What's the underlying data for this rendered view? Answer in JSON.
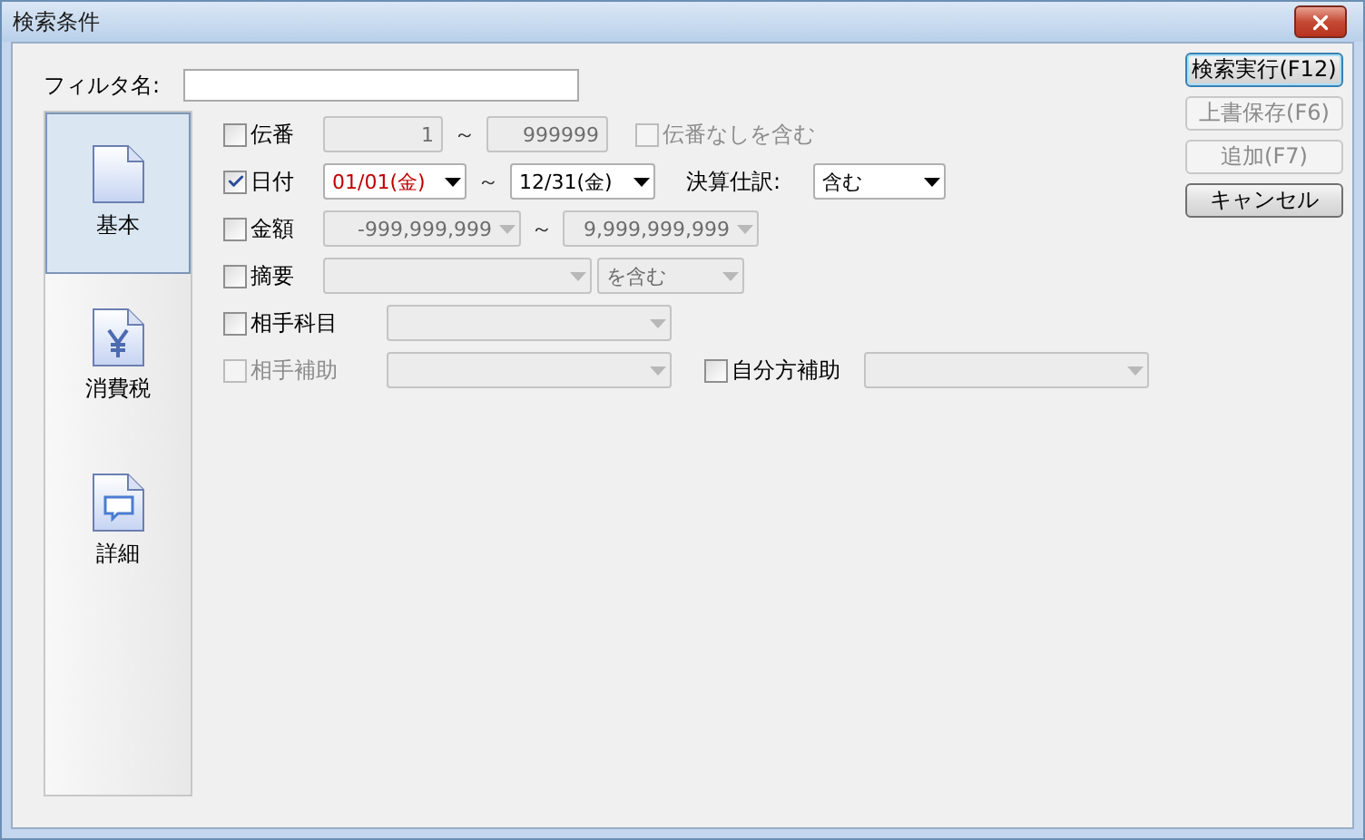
{
  "window": {
    "title": "検索条件"
  },
  "filter_name": {
    "label": "フィルタ名:"
  },
  "sidebar": {
    "items": [
      {
        "label": "基本",
        "selected": true
      },
      {
        "label": "消費税",
        "selected": false
      },
      {
        "label": "詳細",
        "selected": false
      }
    ]
  },
  "rows": [
    {
      "kind": "number_range",
      "label": "伝番",
      "checked": false,
      "disabled": false,
      "from": {
        "value": "1",
        "disabled": true
      },
      "separator": "～",
      "to": {
        "value": "999999",
        "disabled": true
      },
      "option": {
        "label": "伝番なしを含む",
        "checked": false,
        "disabled": true
      }
    },
    {
      "kind": "date_range",
      "label": "日付",
      "checked": true,
      "disabled": false,
      "from": {
        "value": "01/01(金)",
        "disabled": false,
        "emphasis": true
      },
      "separator": "～",
      "to": {
        "value": "12/31(金)",
        "disabled": false,
        "emphasis": false
      },
      "extra_label": "決算仕訳:",
      "extra": {
        "value": "含む",
        "disabled": false
      }
    },
    {
      "kind": "amount_range",
      "label": "金額",
      "checked": false,
      "disabled": false,
      "from": {
        "value": "-999,999,999",
        "disabled": true
      },
      "separator": "～",
      "to": {
        "value": "9,999,999,999",
        "disabled": true
      }
    },
    {
      "kind": "text_match",
      "label": "摘要",
      "checked": false,
      "disabled": false,
      "from": {
        "disabled": true
      },
      "to": {
        "value": "を含む",
        "disabled": true
      }
    },
    {
      "kind": "account",
      "label": "相手科目",
      "checked": false,
      "disabled": false,
      "from": {
        "disabled": true
      }
    },
    {
      "kind": "sub_account",
      "label": "相手補助",
      "checked": false,
      "disabled": true,
      "from": {
        "disabled": true
      },
      "option": {
        "label": "自分方補助",
        "checked": false,
        "disabled": false
      },
      "to": {
        "disabled": true
      }
    }
  ],
  "buttons": [
    {
      "label": "検索実行(F12)",
      "disabled": false,
      "default": true
    },
    {
      "label": "上書保存(F6)",
      "disabled": true,
      "default": false
    },
    {
      "label": "追加(F7)",
      "disabled": true,
      "default": false
    },
    {
      "label": "キャンセル",
      "disabled": false,
      "default": false
    }
  ]
}
